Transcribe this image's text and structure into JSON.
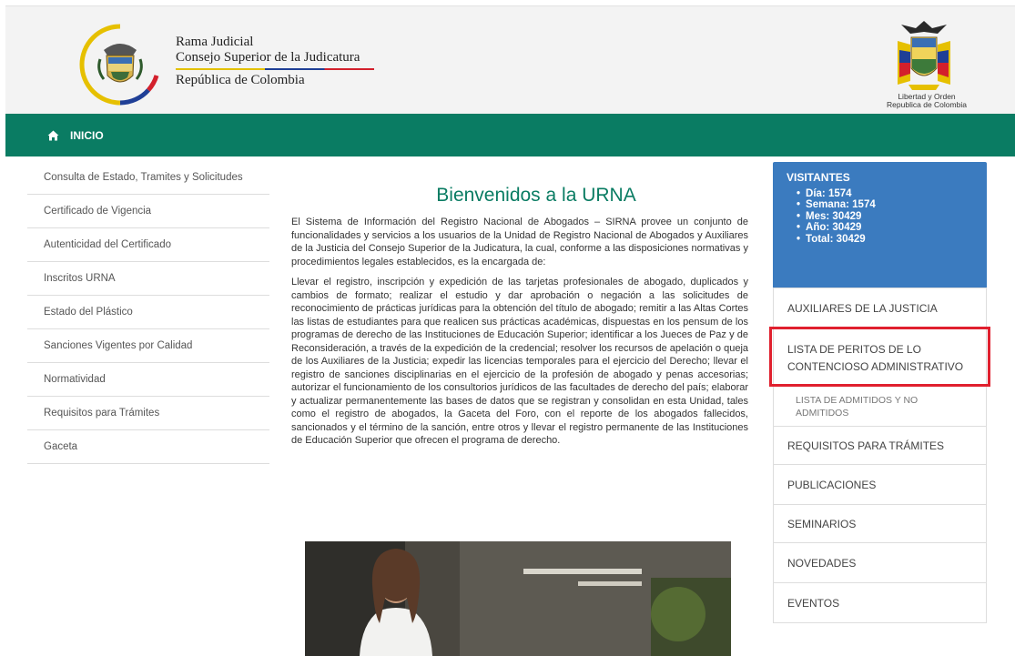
{
  "header": {
    "brand_line1": "Rama Judicial",
    "brand_line2": "Consejo Superior de la Judicatura",
    "brand_line3": "República de Colombia",
    "right_logo_caption_1": "Libertad y Orden",
    "right_logo_caption_2": "Republica de Colombia"
  },
  "navbar": {
    "inicio_label": "INICIO",
    "home_icon": "home-icon"
  },
  "sidebar": {
    "items": [
      {
        "label": "Consulta de Estado, Tramites y Solicitudes"
      },
      {
        "label": "Certificado de Vigencia"
      },
      {
        "label": "Autenticidad del Certificado"
      },
      {
        "label": "Inscritos URNA"
      },
      {
        "label": "Estado del Plástico"
      },
      {
        "label": "Sanciones Vigentes por Calidad"
      },
      {
        "label": "Normatividad"
      },
      {
        "label": "Requisitos para Trámites"
      },
      {
        "label": "Gaceta"
      }
    ]
  },
  "main": {
    "title": "Bienvenidos a la URNA",
    "paragraph1": "El Sistema de Información del Registro Nacional de Abogados – SIRNA provee un conjunto de funcionalidades y servicios a los usuarios de la Unidad de Registro Nacional de Abogados y Auxiliares de la Justicia del Consejo Superior de la Judicatura, la cual, conforme a las disposiciones normativas y procedimientos legales establecidos, es la encargada de:",
    "paragraph2": "Llevar el registro, inscripción y expedición de las tarjetas profesionales de abogado, duplicados y cambios de formato; realizar el estudio y dar aprobación o negación a las solicitudes de reconocimiento de prácticas jurídicas para la obtención del título de abogado; remitir a las Altas Cortes las listas de estudiantes para que realicen sus prácticas académicas, dispuestas en los pensum de los programas de derecho de las Instituciones de Educación Superior; identificar a los Jueces de Paz y de Reconsideración, a través de la expedición de la credencial; resolver los recursos de apelación o queja de los Auxiliares de la Justicia; expedir las licencias temporales para el ejercicio del Derecho; llevar el registro de sanciones disciplinarias en el ejercicio de la profesión de abogado y penas accesorias; autorizar el funcionamiento de los consultorios jurídicos de las facultades de derecho del país; elaborar y actualizar permanentemente las bases de datos que se registran y consolidan en esta Unidad, tales como el registro de abogados, la Gaceta del Foro, con el reporte de los abogados fallecidos, sancionados y el término de la sanción, entre otros y llevar el registro permanente de las Instituciones de Educación Superior que ofrecen el programa de derecho."
  },
  "visitors": {
    "title": "VISITANTES",
    "items": [
      {
        "text": "Día: 1574"
      },
      {
        "text": "Semana: 1574"
      },
      {
        "text": "Mes: 30429"
      },
      {
        "text": "Año: 30429"
      },
      {
        "text": "Total: 30429"
      }
    ]
  },
  "rightmenu": {
    "auxiliares": "AUXILIARES DE LA JUSTICIA",
    "peritos_line1": "LISTA DE PERITOS DE LO",
    "peritos_line2": "CONTENCIOSO ADMINISTRATIVO",
    "admitidos_line1": "LISTA DE ADMITIDOS Y NO",
    "admitidos_line2": "ADMITIDOS",
    "requisitos": "REQUISITOS PARA TRÁMITES",
    "publicaciones": "PUBLICACIONES",
    "seminarios": "SEMINARIOS",
    "novedades": "NOVEDADES",
    "eventos": "EVENTOS"
  },
  "colors": {
    "nav_green": "#0a7c63",
    "visitors_blue": "#3b7bbf",
    "highlight_red": "#e0202e"
  }
}
